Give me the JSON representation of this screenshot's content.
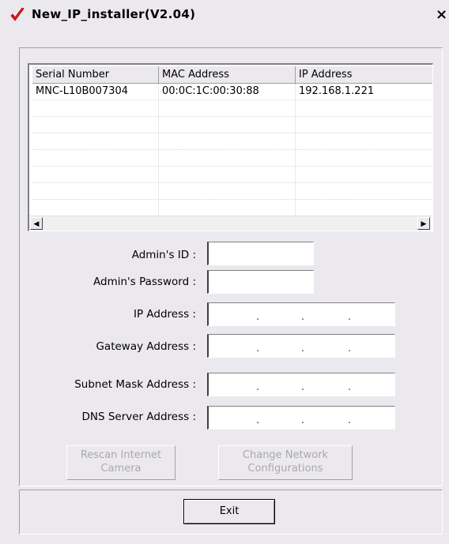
{
  "window": {
    "title": "New_IP_installer(V2.04)",
    "close_label": "×"
  },
  "table": {
    "columns": [
      "Serial Number",
      "MAC Address",
      "IP Address"
    ],
    "rows": [
      [
        "MNC-L10B007304",
        "00:0C:1C:00:30:88",
        "192.168.1.221"
      ]
    ]
  },
  "scrollbar": {
    "left_arrow": "◀",
    "right_arrow": "▶"
  },
  "form": {
    "admin_id_label": "Admin's ID :",
    "admin_id_value": "",
    "admin_password_label": "Admin's Password :",
    "admin_password_value": "",
    "ip_label": "IP Address :",
    "gateway_label": "Gateway Address :",
    "subnet_label": "Subnet Mask Address :",
    "dns_label": "DNS Server Address :"
  },
  "buttons": {
    "rescan_line1": "Rescan Internet",
    "rescan_line2": "Camera",
    "change_line1": "Change Network",
    "change_line2": "Configurations",
    "exit": "Exit"
  },
  "colors": {
    "accent_icon": "#e02020",
    "window_bg": "#ece9ee",
    "disabled_text": "#a8a8b0"
  },
  "icons": {
    "app": "red-checkmark-icon"
  }
}
